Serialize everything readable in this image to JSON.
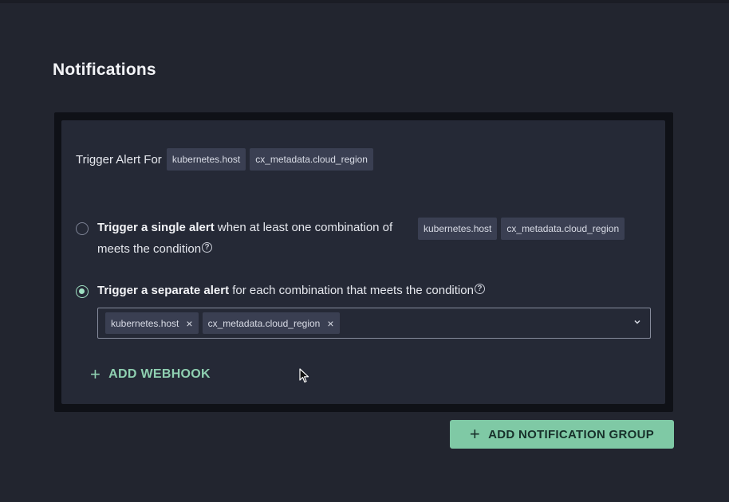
{
  "page": {
    "title": "Notifications"
  },
  "trigger": {
    "label": "Trigger Alert For",
    "fields": [
      "kubernetes.host",
      "cx_metadata.cloud_region"
    ]
  },
  "options": [
    {
      "bold": "Trigger a single alert",
      "rest": " when at least one combination of",
      "line2": "meets the condition",
      "fields": [
        "kubernetes.host",
        "cx_metadata.cloud_region"
      ],
      "selected": false
    },
    {
      "bold": "Trigger a separate alert",
      "rest": " for each combination that meets the condition",
      "selected": true
    }
  ],
  "multiselect": {
    "values": [
      "kubernetes.host",
      "cx_metadata.cloud_region"
    ],
    "remove_glyph": "×"
  },
  "help_glyph": "?",
  "add_webhook": {
    "label": "ADD WEBHOOK",
    "icon": "plus-icon"
  },
  "add_group": {
    "label": "ADD NOTIFICATION GROUP",
    "icon": "plus-icon"
  },
  "colors": {
    "accent": "#7fc9a5",
    "accent_text": "#8fd0b1",
    "background": "#22252f",
    "card": "#252936",
    "chip": "#3a3f52"
  }
}
